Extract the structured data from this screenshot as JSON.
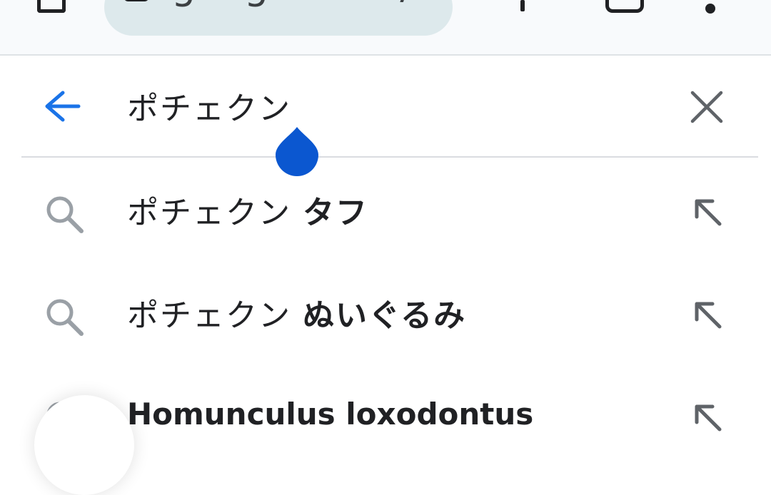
{
  "browser": {
    "url_text": "google.com/sear",
    "icons": [
      "tab-icon",
      "lock-icon",
      "new-tab-plus-icon",
      "tabs-count-icon",
      "overflow-menu-icon"
    ]
  },
  "search": {
    "query": "ポチェクン",
    "back_icon": "arrow-left-icon",
    "clear_icon": "close-icon",
    "accent_color": "#1a73e8",
    "cursor_handle_color": "#0b57d0"
  },
  "suggestions": [
    {
      "prefix": "ポチェクン ",
      "bold": "タフ",
      "icon": "search-icon",
      "action_icon": "arrow-up-left-icon"
    },
    {
      "prefix": "ポチェクン ",
      "bold": "ぬいぐるみ",
      "icon": "search-icon",
      "action_icon": "arrow-up-left-icon"
    },
    {
      "prefix": "",
      "bold": "Homunculus loxodontus",
      "icon": "search-icon",
      "action_icon": "arrow-up-left-icon"
    }
  ]
}
